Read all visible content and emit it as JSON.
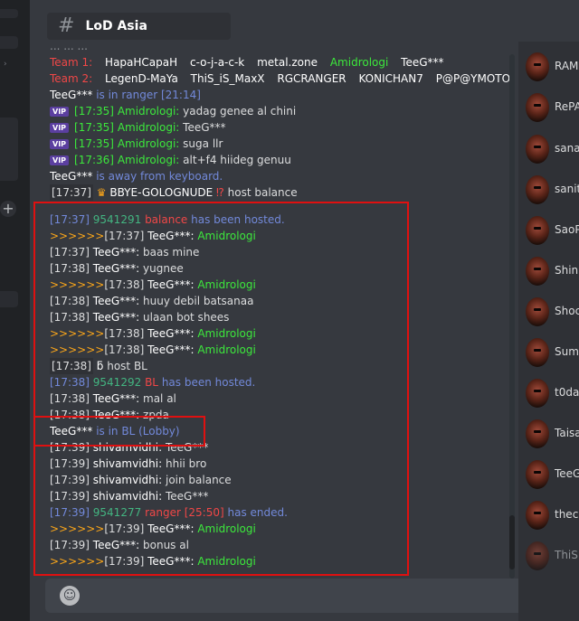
{
  "channel": {
    "name": "LoD Asia"
  },
  "top_partial": "... ... ...",
  "team1": {
    "label": "Team 1:",
    "players": [
      "HapaHCapaH",
      "c-o-j-a-c-k",
      "metal.zone",
      "Amidrologi",
      "TeeG***"
    ]
  },
  "team2": {
    "label": "Team 2:",
    "players": [
      "LegenD-MaYa",
      "ThiS_iS_MaxX",
      "RGCRANGER",
      "KONICHAN7",
      "P@P@YMOTO"
    ]
  },
  "msg_in_ranger": {
    "name": "TeeG***",
    "text": "is in ranger [21:14]"
  },
  "vip_label": "VIP",
  "vip_msgs": [
    {
      "ts": "[17:35]",
      "name": "Amidrologi:",
      "text": "yadag genee al chini"
    },
    {
      "ts": "[17:35]",
      "name": "Amidrologi:",
      "text": "TeeG***"
    },
    {
      "ts": "[17:35]",
      "name": "Amidrologi:",
      "text": "suga llr"
    },
    {
      "ts": "[17:36]",
      "name": "Amidrologi:",
      "text": "alt+f4 hiideg genuu"
    }
  ],
  "away": {
    "name": "TeeG***",
    "text": "is away from keyboard."
  },
  "bbye": {
    "ts": "[17:37]",
    "name": "BBYE-GOLOGNUDE",
    "text": "host balance"
  },
  "hosted_balance": {
    "ts": "[17:37]",
    "id": "9541291",
    "game": "balance",
    "text": "has been hosted."
  },
  "arrow": ">>>>>>",
  "arrow_lines": [
    {
      "ts": "[17:37]",
      "name": "TeeG***:",
      "text": "Amidrologi"
    },
    {
      "ts": "[17:38]",
      "name": "TeeG***:",
      "text": "Amidrologi"
    },
    {
      "ts": "[17:38]",
      "name": "TeeG***:",
      "text": "Amidrologi"
    },
    {
      "ts": "[17:38]",
      "name": "TeeG***:",
      "text": "Amidrologi"
    },
    {
      "ts": "[17:39]",
      "name": "TeeG***:",
      "text": "Amidrologi"
    },
    {
      "ts": "[17:39]",
      "name": "TeeG***:",
      "text": "Amidrologi"
    }
  ],
  "plain_lines": [
    {
      "ts": "[17:37]",
      "name": "TeeG***:",
      "text": "baas mine"
    },
    {
      "ts": "[17:38]",
      "name": "TeeG***:",
      "text": "yugnee"
    },
    {
      "ts": "[17:38]",
      "name": "TeeG***:",
      "text": "huuy debil batsanaa"
    },
    {
      "ts": "[17:38]",
      "name": "TeeG***:",
      "text": "ulaan bot shees"
    },
    {
      "ts": "[17:38]",
      "name": "TeeG***:",
      "text": "mal al"
    },
    {
      "ts": "[17:38]",
      "name": "TeeG***:",
      "text": "zpda"
    },
    {
      "ts": "[17:39]",
      "name": "shivamvidhi:",
      "text": "TeeG***"
    },
    {
      "ts": "[17:39]",
      "name": "shivamvidhi:",
      "text": "hhii bro"
    },
    {
      "ts": "[17:39]",
      "name": "shivamvidhi:",
      "text": "join balance"
    },
    {
      "ts": "[17:39]",
      "name": "shivamvidhi:",
      "text": "TeeG***"
    },
    {
      "ts": "[17:39]",
      "name": "TeeG***:",
      "text": "bonus al"
    }
  ],
  "host_bl": {
    "ts": "[17:38]",
    "text": "host BL"
  },
  "hosted_bl": {
    "ts": "[17:38]",
    "id": "9541292",
    "game": "BL",
    "text": "has been hosted."
  },
  "in_bl": {
    "name": "TeeG***",
    "text": "is in BL (Lobby)"
  },
  "ended": {
    "ts": "[17:39]",
    "id": "9541277",
    "game": "ranger [25:50]",
    "text": "has ended."
  },
  "members": [
    "RAM",
    "RePA",
    "sana",
    "sanit",
    "SaoP",
    "Shin",
    "Shoc",
    "Sum",
    "t0da",
    "Taisa",
    "TeeG",
    "thec",
    "ThiS"
  ],
  "colors": {
    "accent_red": "#e01010",
    "game_blue": "#7289da",
    "arrow_orange": "#faa61a",
    "name_green": "#3ce83c"
  }
}
